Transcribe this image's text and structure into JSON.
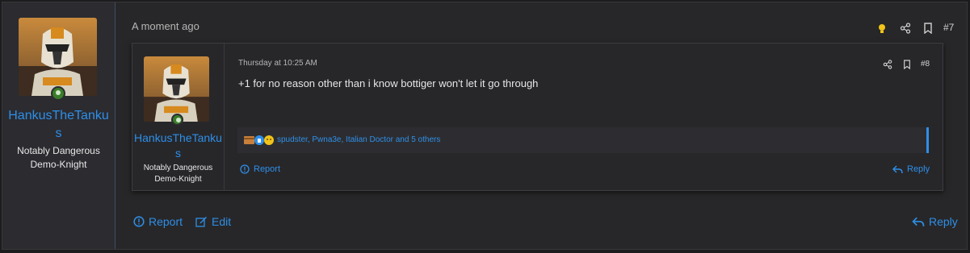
{
  "post": {
    "timestamp": "A moment ago",
    "number": "#7",
    "author": {
      "name": "HankusTheTankus",
      "title": "Notably Dangerous Demo-Knight"
    },
    "actions": {
      "report": "Report",
      "edit": "Edit",
      "reply": "Reply"
    }
  },
  "quoted_post": {
    "timestamp": "Thursday at 10:25 AM",
    "number": "#8",
    "author": {
      "name": "HankusTheTankus",
      "title": "Notably Dangerous Demo-Knight"
    },
    "body": "+1 for no reason other than i know bottiger won't let it go through",
    "reactions": {
      "summary": "spudster, Pwna3e, Italian Doctor and 5 others"
    },
    "actions": {
      "report": "Report",
      "reply": "Reply"
    }
  },
  "colors": {
    "accent": "#2e8fe8",
    "background": "#272729",
    "online": "#3a7d2a",
    "lightbulb": "#f0c419"
  }
}
